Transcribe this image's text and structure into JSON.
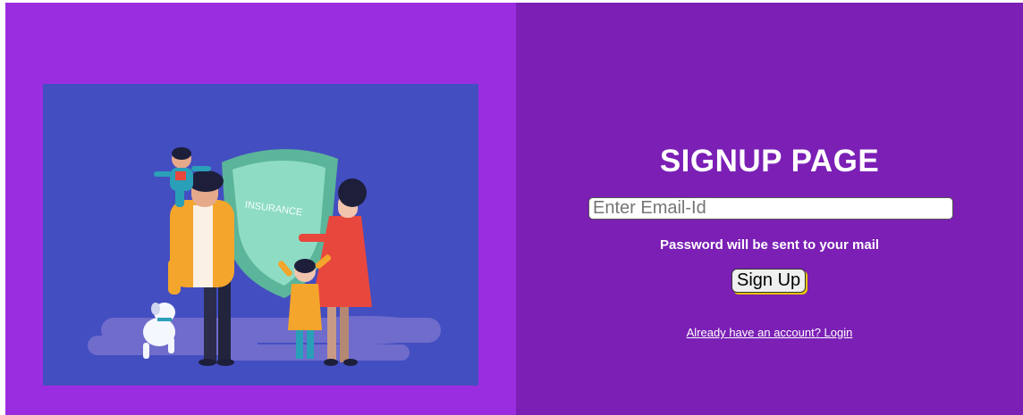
{
  "illustration": {
    "shield_label": "INSURANCE"
  },
  "form": {
    "title": "SIGNUP PAGE",
    "email_placeholder": "Enter Email-Id",
    "email_value": "",
    "hint": "Password will be sent to your mail",
    "submit_label": "Sign Up",
    "login_link": "Already have an account? Login"
  },
  "colors": {
    "left_bg": "#9b2de0",
    "right_bg": "#7b1fb5",
    "illustration_bg": "#434ec0",
    "button_shadow": "#e8c400"
  }
}
